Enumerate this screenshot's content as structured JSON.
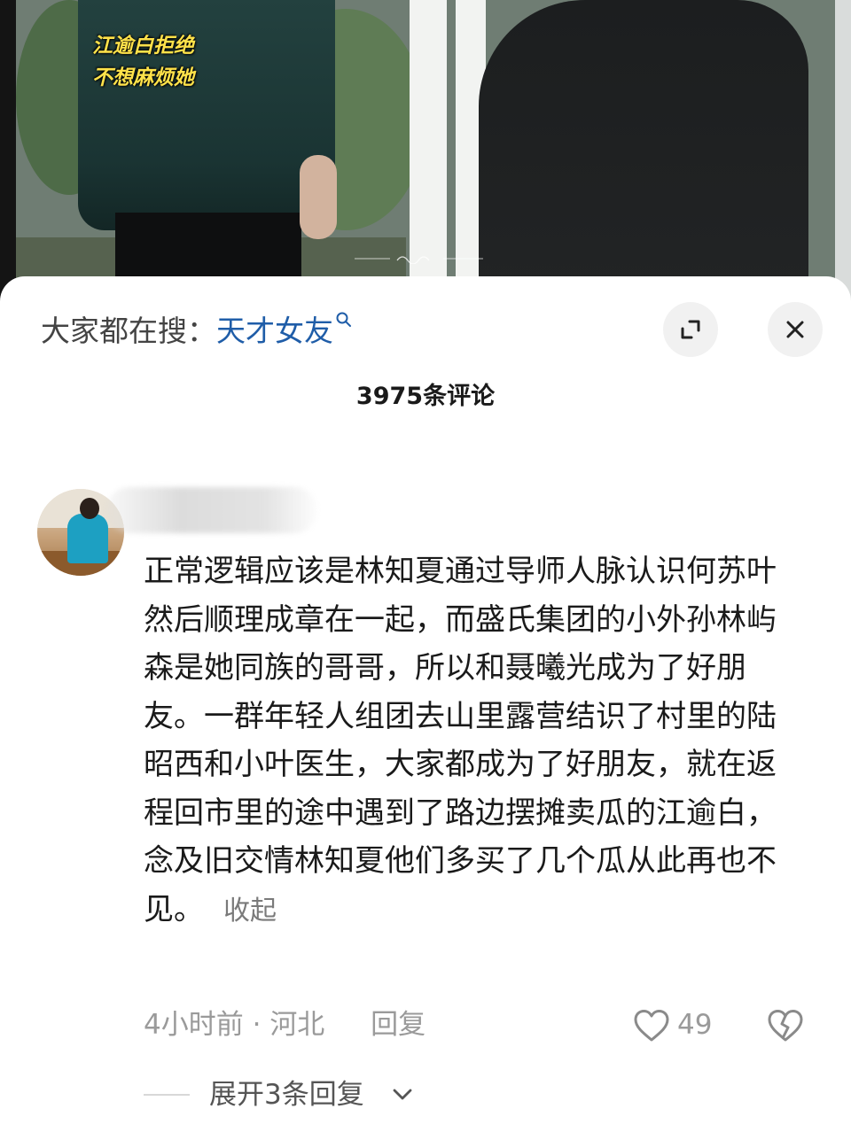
{
  "video": {
    "caption_lines": [
      "江逾白拒绝",
      "不想麻烦她"
    ]
  },
  "sheet": {
    "search_label": "大家都在搜：",
    "search_term": "天才女友",
    "comment_count": "3975条评论"
  },
  "comment": {
    "text": "正常逻辑应该是林知夏通过导师人脉认识何苏叶然后顺理成章在一起，而盛氏集团的小外孙林屿森是她同族的哥哥，所以和聂曦光成为了好朋友。一群年轻人组团去山里露营结识了村里的陆昭西和小叶医生，大家都成为了好朋友，就在返程回市里的途中遇到了路边摆摊卖瓜的江逾白，念及旧交情林知夏他们多买了几个瓜从此再也不见。",
    "collapse_label": "收起",
    "time": "4小时前",
    "separator": "·",
    "location": "河北",
    "reply_label": "回复",
    "like_count": "49",
    "expand_replies": "展开3条回复"
  },
  "icons": {
    "search_hint": "magnifier-icon",
    "expand": "expand-icon",
    "close": "close-icon",
    "like": "heart-outline-icon",
    "dislike": "broken-heart-icon",
    "chevron": "chevron-down-icon"
  },
  "colors": {
    "search_term": "#1f5da8",
    "caption": "#ffe24a",
    "muted": "#9a9a9a"
  }
}
